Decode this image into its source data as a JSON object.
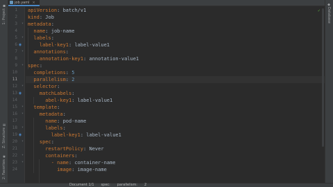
{
  "tab": {
    "filename": "job.yaml"
  },
  "left_tool_windows": [
    {
      "label": "1: Project"
    },
    {
      "label": "Z: Structure"
    },
    {
      "label": "2: Favorites"
    }
  ],
  "right_tool_windows": [
    {
      "label": "Database"
    }
  ],
  "line_numbers": [
    "1",
    "2",
    "3",
    "4",
    "5",
    "6",
    "7",
    "8",
    "9",
    "10",
    "11",
    "12",
    "13",
    "14",
    "15",
    "16",
    "17",
    "18",
    "19",
    "20",
    "21",
    "22",
    "23",
    "24"
  ],
  "current_line": 11,
  "code": [
    [
      {
        "t": "apiVersion",
        "c": "k"
      },
      {
        "t": ": batch/v1",
        "c": "v"
      }
    ],
    [
      {
        "t": "kind",
        "c": "k"
      },
      {
        "t": ": Job",
        "c": "v"
      }
    ],
    [
      {
        "t": "metadata",
        "c": "k"
      },
      {
        "t": ":",
        "c": "v"
      }
    ],
    [
      {
        "t": "  name",
        "c": "k"
      },
      {
        "t": ": job-name",
        "c": "v"
      }
    ],
    [
      {
        "t": "  labels",
        "c": "k"
      },
      {
        "t": ":",
        "c": "v"
      }
    ],
    [
      {
        "t": "    label-key1",
        "c": "k"
      },
      {
        "t": ": label-value1",
        "c": "v"
      }
    ],
    [
      {
        "t": "  annotations",
        "c": "k"
      },
      {
        "t": ":",
        "c": "v"
      }
    ],
    [
      {
        "t": "    annotation-key1",
        "c": "k"
      },
      {
        "t": ": annotation-value1",
        "c": "v"
      }
    ],
    [
      {
        "t": "spec",
        "c": "k"
      },
      {
        "t": ":",
        "c": "v"
      }
    ],
    [
      {
        "t": "  completions",
        "c": "k"
      },
      {
        "t": ": ",
        "c": "v"
      },
      {
        "t": "5",
        "c": "n"
      }
    ],
    [
      {
        "t": "  parallelism",
        "c": "k"
      },
      {
        "t": ": ",
        "c": "v"
      },
      {
        "t": "2",
        "c": "n"
      }
    ],
    [
      {
        "t": "  selector",
        "c": "k"
      },
      {
        "t": ":",
        "c": "v"
      }
    ],
    [
      {
        "t": "    matchLabels",
        "c": "k"
      },
      {
        "t": ":",
        "c": "v"
      }
    ],
    [
      {
        "t": "      abel-key1",
        "c": "k"
      },
      {
        "t": ": label-value1",
        "c": "v"
      }
    ],
    [
      {
        "t": "  template",
        "c": "k"
      },
      {
        "t": ":",
        "c": "v"
      }
    ],
    [
      {
        "t": "    metadata",
        "c": "k"
      },
      {
        "t": ":",
        "c": "v"
      }
    ],
    [
      {
        "t": "      name",
        "c": "k"
      },
      {
        "t": ": pod-name",
        "c": "v"
      }
    ],
    [
      {
        "t": "      labels",
        "c": "k"
      },
      {
        "t": ":",
        "c": "v"
      }
    ],
    [
      {
        "t": "        label-key1",
        "c": "k"
      },
      {
        "t": ": label-value1",
        "c": "v"
      }
    ],
    [
      {
        "t": "    spec",
        "c": "k"
      },
      {
        "t": ":",
        "c": "v"
      }
    ],
    [
      {
        "t": "      restartPolicy",
        "c": "k"
      },
      {
        "t": ": Never",
        "c": "v"
      }
    ],
    [
      {
        "t": "      containers",
        "c": "k"
      },
      {
        "t": ":",
        "c": "v"
      }
    ],
    [
      {
        "t": "        - name",
        "c": "k"
      },
      {
        "t": ": container-name",
        "c": "v"
      }
    ],
    [
      {
        "t": "          image",
        "c": "k"
      },
      {
        "t": ": image-name",
        "c": "v"
      }
    ]
  ],
  "breadcrumb": {
    "document": "Document 1/1",
    "spec": "spec:",
    "parallelism": "parallelism:",
    "value": "2"
  }
}
